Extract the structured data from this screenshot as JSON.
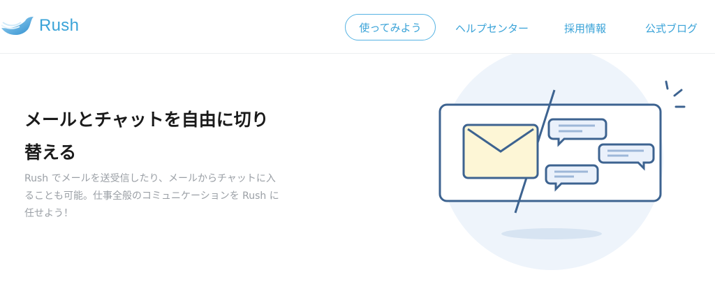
{
  "header": {
    "logo_text": "Rush",
    "nav": {
      "cta_label": "使ってみよう",
      "help_label": "ヘルプセンター",
      "jobs_label": "採用情報",
      "blog_label": "公式ブログ"
    }
  },
  "hero": {
    "title_line1": "メールとチャットを自由に切り",
    "title_line2": "替える",
    "desc_line1": "Rush でメールを送受信したり、メールからチャットに入",
    "desc_line2": "ることも可能。仕事全般のコミュニケーションを Rush に",
    "desc_line3": "任せよう！"
  },
  "colors": {
    "brand_blue": "#3aa3d8",
    "illustration_outline": "#3d6390",
    "envelope_fill": "#fdf6d6",
    "bubble_fill": "#eaf1fb",
    "circle_bg": "#eef4fb"
  },
  "icons": {
    "logo": "bird-logo-icon",
    "illustration": "mail-to-chat-illustration"
  }
}
